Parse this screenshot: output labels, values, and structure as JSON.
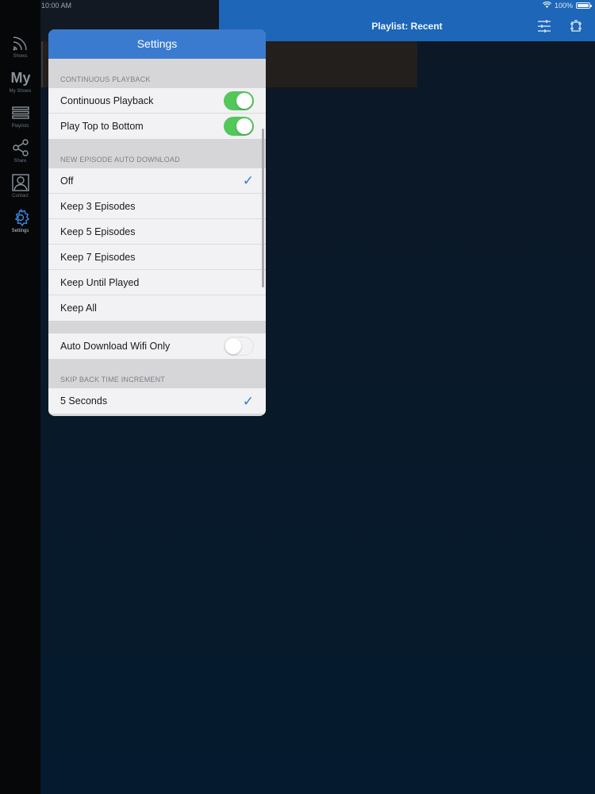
{
  "status_bar": {
    "time": "10:00 AM",
    "battery": "100%"
  },
  "sidebar": {
    "items": [
      {
        "label": "Shows",
        "icon": "rss-icon"
      },
      {
        "label": "My Shows",
        "icon": "my-icon",
        "glyph": "My"
      },
      {
        "label": "Playlists",
        "icon": "list-icon"
      },
      {
        "label": "Share",
        "icon": "share-icon"
      },
      {
        "label": "Contact",
        "icon": "contact-icon"
      },
      {
        "label": "Settings",
        "icon": "gear-icon",
        "active": true
      }
    ]
  },
  "detail": {
    "title": "Playlist: Recent"
  },
  "settings": {
    "title": "Settings",
    "sections": {
      "continuous": {
        "header": "CONTINUOUS PLAYBACK",
        "rows": [
          {
            "label": "Continuous Playback",
            "on": true
          },
          {
            "label": "Play Top to Bottom",
            "on": true
          }
        ]
      },
      "auto_download": {
        "header": "NEW EPISODE AUTO DOWNLOAD",
        "rows": [
          {
            "label": "Off",
            "checked": true
          },
          {
            "label": "Keep 3 Episodes"
          },
          {
            "label": "Keep 5 Episodes"
          },
          {
            "label": "Keep 7 Episodes"
          },
          {
            "label": "Keep Until Played"
          },
          {
            "label": "Keep All"
          }
        ]
      },
      "wifi": {
        "rows": [
          {
            "label": "Auto Download Wifi Only",
            "on": false
          }
        ]
      },
      "skip_back": {
        "header": "SKIP BACK TIME INCREMENT",
        "rows": [
          {
            "label": "5 Seconds",
            "checked": true
          }
        ]
      }
    }
  },
  "colors": {
    "accent": "#3a7bd0",
    "nav_bar": "#1d66b8",
    "toggle_on": "#52c75a",
    "check": "#2f7ad6"
  }
}
